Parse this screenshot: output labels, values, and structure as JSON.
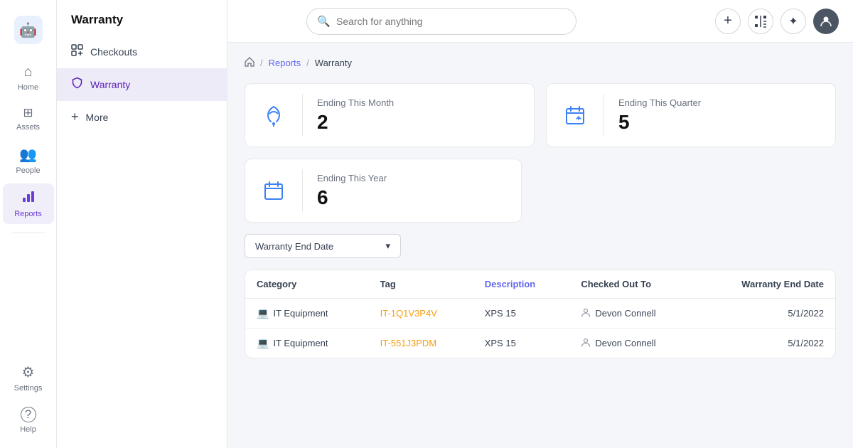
{
  "app": {
    "logo_emoji": "🤖",
    "title": "Warranty"
  },
  "icon_nav": {
    "items": [
      {
        "id": "home",
        "label": "Home",
        "icon": "⌂",
        "active": false
      },
      {
        "id": "assets",
        "label": "Assets",
        "icon": "▦",
        "active": false
      },
      {
        "id": "people",
        "label": "People",
        "icon": "👥",
        "active": false
      },
      {
        "id": "reports",
        "label": "Reports",
        "icon": "📊",
        "active": true
      }
    ],
    "bottom_items": [
      {
        "id": "settings",
        "label": "Settings",
        "icon": "⚙",
        "active": false
      },
      {
        "id": "help",
        "label": "Help",
        "icon": "?",
        "active": false
      }
    ]
  },
  "secondary_nav": {
    "title": "Warranty",
    "items": [
      {
        "id": "checkouts",
        "label": "Checkouts",
        "icon": "≡",
        "active": false
      },
      {
        "id": "warranty",
        "label": "Warranty",
        "icon": "🛡",
        "active": true
      },
      {
        "id": "more",
        "label": "More",
        "icon": "+",
        "active": false
      }
    ]
  },
  "topbar": {
    "search_placeholder": "Search for anything",
    "add_icon": "+",
    "scan_icon": "⊞"
  },
  "breadcrumb": {
    "home_icon": "⌂",
    "separator": "/",
    "reports_label": "Reports",
    "current_label": "Warranty"
  },
  "stats": {
    "cards": [
      {
        "id": "ending-month",
        "label": "Ending This Month",
        "value": "2",
        "icon": "🔔"
      },
      {
        "id": "ending-quarter",
        "label": "Ending This Quarter",
        "value": "5",
        "icon": "📅"
      }
    ],
    "card_single": {
      "id": "ending-year",
      "label": "Ending This Year",
      "value": "6",
      "icon": "📅"
    }
  },
  "filter": {
    "label": "Warranty End Date",
    "chevron": "▾"
  },
  "table": {
    "columns": [
      {
        "id": "category",
        "label": "Category",
        "align": "left"
      },
      {
        "id": "tag",
        "label": "Tag",
        "align": "left"
      },
      {
        "id": "description",
        "label": "Description",
        "align": "left"
      },
      {
        "id": "checked_out_to",
        "label": "Checked Out To",
        "align": "left"
      },
      {
        "id": "warranty_end_date",
        "label": "Warranty End Date",
        "align": "right"
      }
    ],
    "rows": [
      {
        "category": "IT Equipment",
        "category_icon": "💻",
        "tag": "IT-1Q1V3P4V",
        "description": "XPS 15",
        "checked_out_to": "Devon Connell",
        "warranty_end_date": "5/1/2022"
      },
      {
        "category": "IT Equipment",
        "category_icon": "💻",
        "tag": "IT-551J3PDM",
        "description": "XPS 15",
        "checked_out_to": "Devon Connell",
        "warranty_end_date": "5/1/2022"
      }
    ]
  }
}
